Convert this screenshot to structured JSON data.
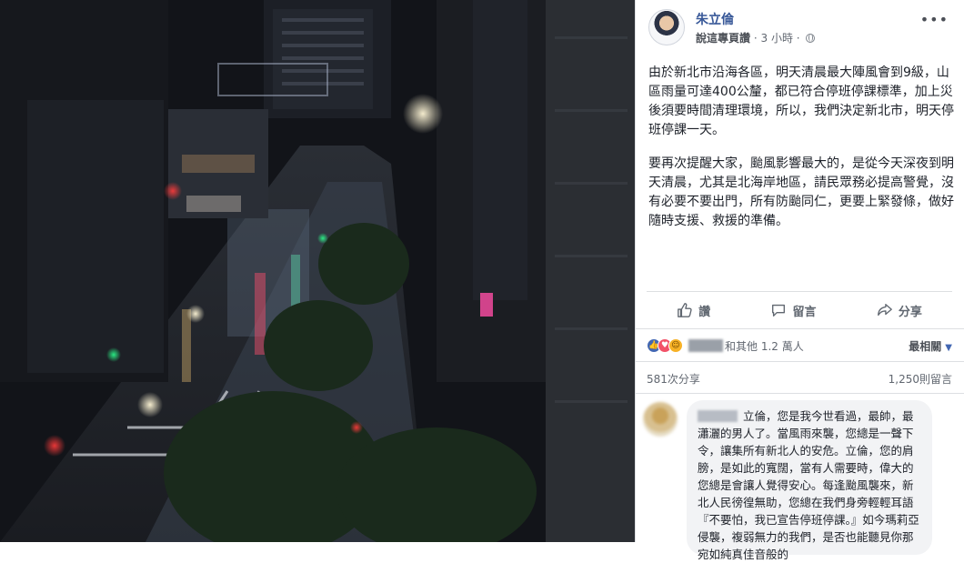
{
  "post": {
    "author": "朱立倫",
    "liked_page": "說這專頁讚",
    "separator": "·",
    "timestamp": "3 小時",
    "more": "•••",
    "paragraphs": [
      "由於新北市沿海各區，明天清晨最大陣風會到9級，山區雨量可達400公釐，都已符合停班停課標準，加上災後須要時間清理環境，所以，我們決定新北市，明天停班停課一天。",
      "要再次提醒大家，颱風影響最大的，是從今天深夜到明天清晨，尤其是北海岸地區，請民眾務必提高警覺，沒有必要不要出門，所有防颱同仁，更要上緊發條，做好隨時支援、救援的準備。"
    ]
  },
  "actions": {
    "like": "讚",
    "comment": "留言",
    "share": "分享"
  },
  "reactions": {
    "others_text": "和其他 1.2 萬人",
    "sort_label": "最相關",
    "sort_caret": "▼"
  },
  "counts": {
    "shares": "581次分享",
    "comments": "1,250則留言"
  },
  "comment": {
    "text": "立倫，您是我今世看過，最帥，最瀟灑的男人了。當風雨來襲，您總是一聲下令，讓集所有新北人的安危。立倫，您的肩膀，是如此的寬闊，當有人需要時，偉大的您總是會讓人覺得安心。每逢颱風襲來，新北人民徬徨無助，您總在我們身旁輕輕耳語『不要怕，我已宣告停班停課。』如今瑪莉亞侵襲，複弱無力的我們，是否也能聽見你那宛如純真佳音般的"
  },
  "colors": {
    "link": "#385898",
    "like_blue": "#4267b2",
    "love_red": "#f25268",
    "haha_yellow": "#f7b125"
  }
}
